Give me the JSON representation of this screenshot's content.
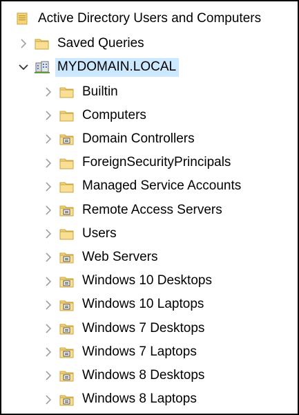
{
  "tree": {
    "root": {
      "label": "Active Directory Users and Computers",
      "icon": "console-root-icon"
    },
    "saved_queries": {
      "label": "Saved Queries",
      "icon": "folder-icon",
      "expander": "collapsed"
    },
    "domain": {
      "label": "MYDOMAIN.LOCAL",
      "icon": "domain-icon",
      "expander": "expanded",
      "selected": true
    },
    "children": [
      {
        "label": "Builtin",
        "icon": "folder-icon"
      },
      {
        "label": "Computers",
        "icon": "folder-icon"
      },
      {
        "label": "Domain Controllers",
        "icon": "organizational-unit-icon"
      },
      {
        "label": "ForeignSecurityPrincipals",
        "icon": "folder-icon"
      },
      {
        "label": "Managed Service Accounts",
        "icon": "folder-icon"
      },
      {
        "label": "Remote Access Servers",
        "icon": "organizational-unit-icon"
      },
      {
        "label": "Users",
        "icon": "folder-icon"
      },
      {
        "label": "Web Servers",
        "icon": "organizational-unit-icon"
      },
      {
        "label": "Windows 10 Desktops",
        "icon": "organizational-unit-icon"
      },
      {
        "label": "Windows 10 Laptops",
        "icon": "organizational-unit-icon"
      },
      {
        "label": "Windows 7 Desktops",
        "icon": "organizational-unit-icon"
      },
      {
        "label": "Windows 7 Laptops",
        "icon": "organizational-unit-icon"
      },
      {
        "label": "Windows 8 Desktops",
        "icon": "organizational-unit-icon"
      },
      {
        "label": "Windows 8 Laptops",
        "icon": "organizational-unit-icon"
      }
    ]
  },
  "colors": {
    "selection": "#cce8ff",
    "folder": "#f5d47a",
    "folder_edge": "#c9a33c",
    "chevron": "#a0a0a0"
  }
}
